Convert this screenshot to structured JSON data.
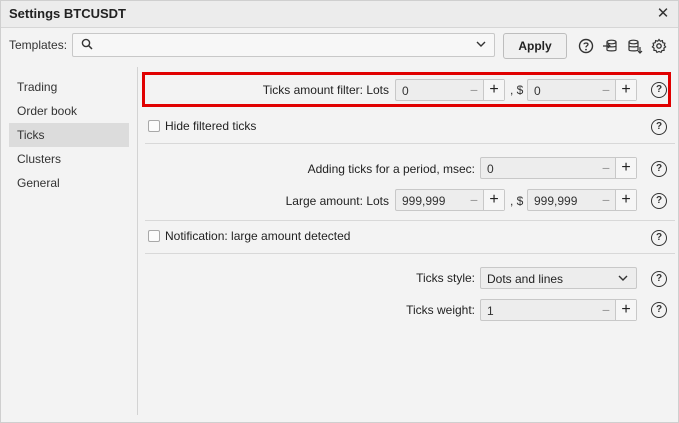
{
  "window": {
    "title": "Settings BTCUSDT"
  },
  "templates": {
    "label": "Templates:",
    "value": "",
    "apply_label": "Apply"
  },
  "sidebar": {
    "items": [
      {
        "label": "Trading"
      },
      {
        "label": "Order book"
      },
      {
        "label": "Ticks",
        "active": true
      },
      {
        "label": "Clusters"
      },
      {
        "label": "General"
      }
    ]
  },
  "settings": {
    "ticks_filter": {
      "label": "Ticks amount filter: Lots",
      "lots_value": "0",
      "sep": ", $",
      "usd_value": "0"
    },
    "hide_filtered": {
      "label": "Hide filtered ticks",
      "checked": false
    },
    "adding_ticks": {
      "label": "Adding ticks for a period, msec:",
      "value": "0"
    },
    "large_amount": {
      "label": "Large amount: Lots",
      "lots_value": "999,999",
      "sep": ", $",
      "usd_value": "999,999"
    },
    "notification": {
      "label": "Notification: large amount detected",
      "checked": false
    },
    "ticks_style": {
      "label": "Ticks style:",
      "value": "Dots and lines"
    },
    "ticks_weight": {
      "label": "Ticks weight:",
      "value": "1"
    }
  },
  "icons": {
    "help": "?",
    "close": "✕",
    "minus": "−",
    "plus": "+"
  },
  "colors": {
    "highlight": "#e00000",
    "active_nav": "#dcdcdc"
  }
}
